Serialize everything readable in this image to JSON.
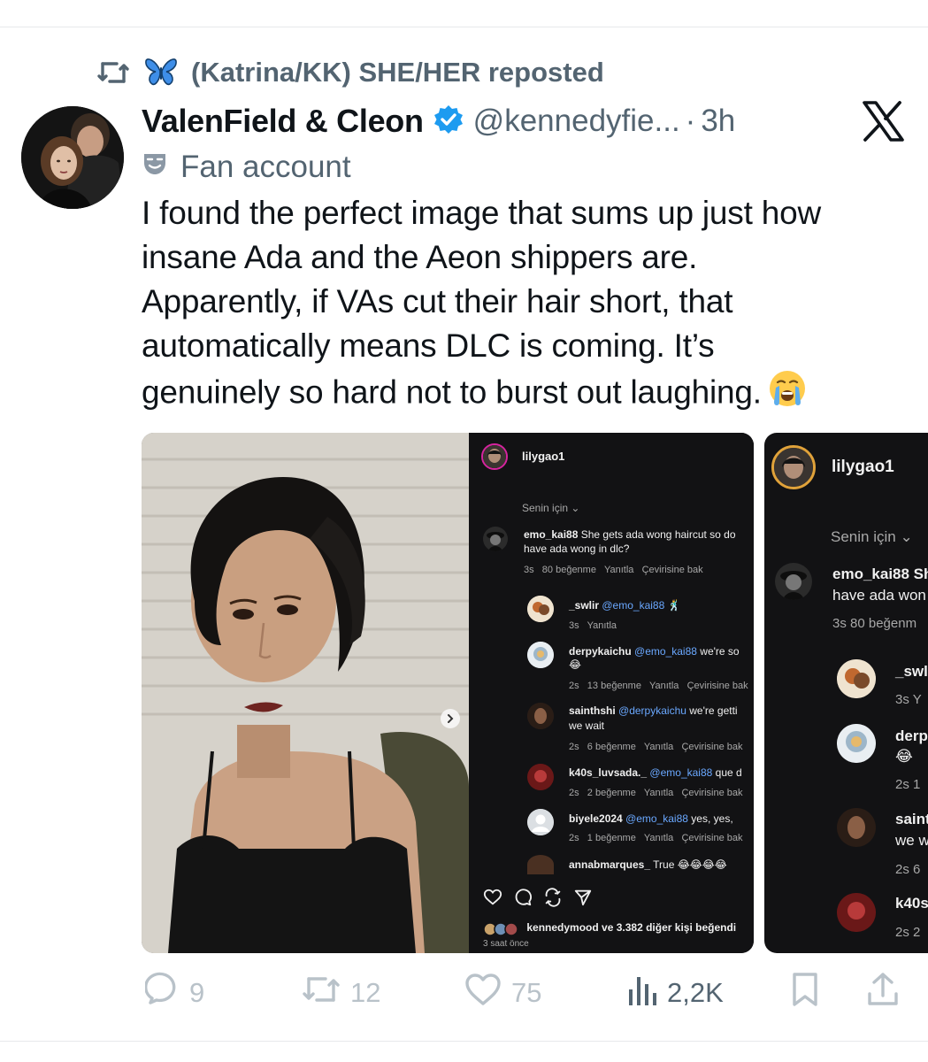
{
  "repost": {
    "text": "(Katrina/KK) SHE/HER reposted",
    "icon": "repost-icon",
    "emoji_icon": "butterfly-icon"
  },
  "tweet": {
    "display_name": "ValenField & Cleon",
    "handle": "@kennedyfie...",
    "separator": "·",
    "time": "3h",
    "label": "Fan account",
    "body_lines": [
      "I found the perfect image that sums up just how",
      "insane Ada and the Aeon shippers are.",
      "Apparently, if VAs cut their hair short, that",
      "automatically means DLC is coming. It’s",
      "genuinely so hard not to burst out laughing."
    ]
  },
  "media": {
    "panel": {
      "username": "lilygao1",
      "section": "Senin için",
      "comments": [
        {
          "user": "emo_kai88",
          "text": "She gets ada wong haircut so do",
          "text2": "have ada wong in dlc?",
          "meta": [
            "3s",
            "80 beğenme",
            "Yanıtla",
            "Çevirisine bak"
          ]
        },
        {
          "user": "_swlir",
          "mention": "@emo_kai88",
          "text": "",
          "meta": [
            "3s",
            "Yanıtla"
          ]
        },
        {
          "user": "derpykaichu",
          "mention": "@emo_kai88",
          "text": "we're so",
          "meta": [
            "2s",
            "13 beğenme",
            "Yanıtla",
            "Çevirisine bak"
          ]
        },
        {
          "user": "sainthshi",
          "mention": "@derpykaichu",
          "text": "we're getti",
          "text2": "we wait",
          "meta": [
            "2s",
            "6 beğenme",
            "Yanıtla",
            "Çevirisine bak"
          ]
        },
        {
          "user": "k40s_luvsada._",
          "mention": "@emo_kai88",
          "text": "que d",
          "meta": [
            "2s",
            "2 beğenme",
            "Yanıtla",
            "Çevirisine bak"
          ]
        },
        {
          "user": "biyele2024",
          "mention": "@emo_kai88",
          "text": "yes, yes,",
          "meta": [
            "2s",
            "1 beğenme",
            "Yanıtla",
            "Çevirisine bak"
          ]
        },
        {
          "user": "annabmarques_",
          "text": "True"
        }
      ],
      "liked_by_user": "kennedymood",
      "liked_by_text": "ve 3.382 diğer kişi beğendi",
      "posted_ago": "3 saat önce"
    },
    "second_panel": {
      "username": "lilygao1",
      "section": "Senin için",
      "comments": [
        {
          "user": "emo_kai88 Sh",
          "text": "have ada won",
          "meta": "3s  80 beğenm"
        },
        {
          "user": "_swli",
          "meta": "3s  Y"
        },
        {
          "user": "derp",
          "meta": "2s  1"
        },
        {
          "user": "saint",
          "text": "we w",
          "meta": "2s  6"
        },
        {
          "user": "k40s",
          "meta": "2s  2"
        }
      ]
    }
  },
  "actions": {
    "replies": "9",
    "reposts": "12",
    "likes": "75",
    "views": "2,2K"
  },
  "colors": {
    "text_primary": "#0f1419",
    "text_secondary": "#536471",
    "verified": "#1d9bf0",
    "action_faded": "#b9c2c9",
    "divider": "#e7e9eb",
    "dark_panel": "#121214",
    "mention": "#6aa8ff"
  }
}
